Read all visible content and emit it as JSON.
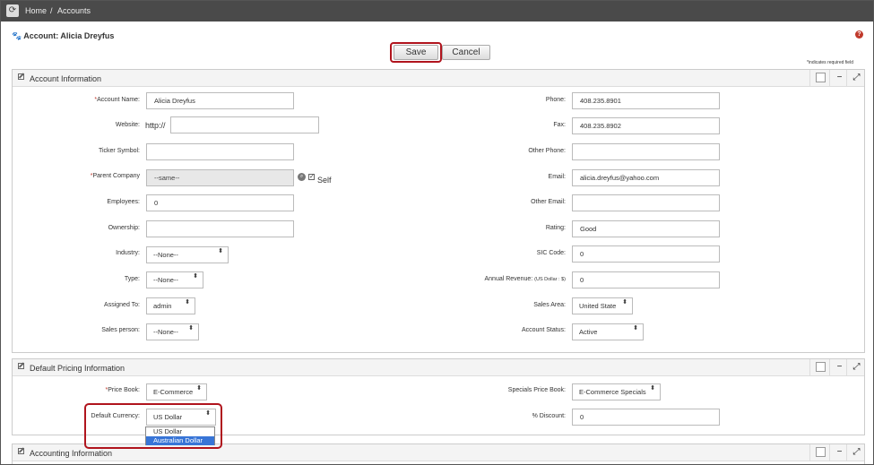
{
  "breadcrumb": {
    "home": "Home",
    "sep": "/",
    "current": "Accounts"
  },
  "record_title": "Account: Alicia Dreyfus",
  "icons": {
    "logo": "refresh-logo-icon",
    "paw": "paw-icon",
    "help": "help-icon",
    "edit": "edit-icon",
    "search": "search-icon",
    "sort": "select-arrows-icon"
  },
  "colors": {
    "topbar": "#4a4a4a",
    "highlight": "#b0141d",
    "required": "#c0392b",
    "selected_option": "#3875d7"
  },
  "glyphs": {
    "paw": "🐾",
    "help": "?",
    "logo": "⟳",
    "search": "⌕",
    "check": "✓",
    "minimize": "−",
    "expand": "⤢",
    "sort": "⬍"
  },
  "toolbar": {
    "save": "Save",
    "cancel": "Cancel",
    "required_note": "*indicates required field"
  },
  "sections": {
    "account": "Account Information",
    "pricing": "Default Pricing Information",
    "accounting": "Accounting Information"
  },
  "left_fields": [
    {
      "req": "*",
      "label": "Account Name:",
      "value": "Alicia Dreyfus"
    },
    {
      "label": "Website:",
      "prefix": "http://",
      "value": ""
    },
    {
      "label": "Ticker Symbol:",
      "value": ""
    },
    {
      "req": "*",
      "label": "Parent Company",
      "value": "--same--",
      "check_label": "Self"
    },
    {
      "label": "Employees:",
      "value": "0"
    },
    {
      "label": "Ownership:",
      "value": ""
    },
    {
      "label": "Industry:",
      "value": "--None--"
    },
    {
      "label": "Type:",
      "value": "--None--"
    },
    {
      "label": "Assigned To:",
      "value": "admin"
    },
    {
      "label": "Sales person:",
      "value": "--None--"
    }
  ],
  "right_fields": [
    {
      "label": "Phone:",
      "value": "408.235.8901"
    },
    {
      "label": "Fax:",
      "value": "408.235.8902"
    },
    {
      "label": "Other Phone:",
      "value": ""
    },
    {
      "label": "Email:",
      "value": "alicia.dreyfus@yahoo.com"
    },
    {
      "label": "Other Email:",
      "value": ""
    },
    {
      "label": "Rating:",
      "value": "Good"
    },
    {
      "label": "SIC Code:",
      "value": "0"
    },
    {
      "label": "Annual Revenue:",
      "label_small": "(US Dollar : $)",
      "value": "0"
    },
    {
      "label": "Sales Area:",
      "value": "United State"
    },
    {
      "label": "Account Status:",
      "value": "Active"
    }
  ],
  "pricing": {
    "price_book": {
      "req": "*",
      "label": "Price Book:",
      "value": "E-Commerce"
    },
    "currency": {
      "label": "Default Currency:",
      "value": "US Dollar",
      "options": [
        "US Dollar",
        "Australian Dollar"
      ]
    },
    "specials": {
      "label": "Specials Price Book:",
      "value": "E-Commerce Specials"
    },
    "discount": {
      "label": "% Discount:",
      "value": "0"
    }
  }
}
